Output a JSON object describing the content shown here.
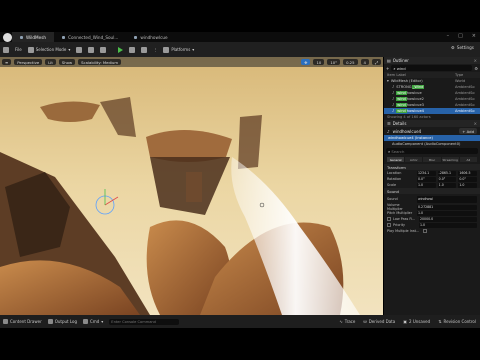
{
  "tabs": [
    {
      "label": "WildMesh",
      "active": true
    },
    {
      "label": "Connected_Wind_Soul...",
      "active": false
    },
    {
      "label": "windhowlcue",
      "active": false
    }
  ],
  "toolbar": {
    "file_menu": "File",
    "selection_mode": "Selection Mode",
    "platforms": "Platforms",
    "settings": "Settings"
  },
  "viewport": {
    "perspective": "Perspective",
    "lit": "Lit",
    "show": "Show",
    "scalability": "Scalability: Medium",
    "grid_snap": "10",
    "rot_snap": "10°",
    "scale_snap": "0.25",
    "camera_speed": "4"
  },
  "outliner": {
    "title": "Outliner",
    "search_value": "wind",
    "col_item": "Item Label",
    "col_type": "Type",
    "rows": [
      {
        "prefix": "",
        "hl": "",
        "suffix": "WildMesh (Editor)",
        "type": "World",
        "selected": false
      },
      {
        "prefix": "STRONG",
        "hl": "_Wind",
        "suffix": "",
        "type": "AmbientSo",
        "selected": false
      },
      {
        "prefix": "",
        "hl": "wind",
        "suffix": "howlcue",
        "type": "AmbientSo",
        "selected": false
      },
      {
        "prefix": "",
        "hl": "wind",
        "suffix": "howlcue2",
        "type": "AmbientSo",
        "selected": false
      },
      {
        "prefix": "",
        "hl": "wind",
        "suffix": "howlcue3",
        "type": "AmbientSo",
        "selected": false
      },
      {
        "prefix": "",
        "hl": "wind",
        "suffix": "howlcue4",
        "type": "AmbientSo",
        "selected": true
      }
    ],
    "status": "Showing 4 of 160 actors"
  },
  "details": {
    "title": "Details",
    "actor_name": "windhowlcue4",
    "add_label": "+ Add",
    "components": [
      {
        "label": "windhowlcue4 (Instance)",
        "selected": true
      },
      {
        "label": "AudioComponent (AudioComponent0)",
        "selected": false
      }
    ],
    "search_placeholder": "Search",
    "categories": [
      "General",
      "Actor",
      "Misc",
      "Streaming",
      "All"
    ],
    "transform_header": "Transform",
    "location_label": "Location",
    "location": [
      "1234.1",
      "-2865.1",
      "1606.5"
    ],
    "rotation_label": "Rotation",
    "rotation": [
      "0.0°",
      "0.0°",
      "0.0°"
    ],
    "scale_label": "Scale",
    "scale": [
      "1.0",
      "1.0",
      "1.0"
    ],
    "sound_header": "Sound",
    "sound_label": "Sound",
    "sound_value": "windhowl",
    "volume_label": "Volume Multiplier",
    "volume_value": "0.272881",
    "pitch_label": "Pitch Multiplier",
    "pitch_value": "1.0",
    "low_pass_label": "Low Pass Fi...",
    "low_pass_value": "20000.0",
    "priority_label": "Priority",
    "priority_value": "1.0",
    "play_multiple_label": "Play Multiple Inst..."
  },
  "bottombar": {
    "content_drawer": "Content Drawer",
    "output_log": "Output Log",
    "cmd": "Cmd",
    "cmd_placeholder": "Enter Console Command",
    "trace": "Trace",
    "derived_data": "Derived Data",
    "unsaved": "2 Unsaved",
    "revision_control": "Revision Control"
  },
  "colors": {
    "accent": "#2762a8",
    "highlight": "#3fa33f",
    "play": "#4bbf4b"
  }
}
